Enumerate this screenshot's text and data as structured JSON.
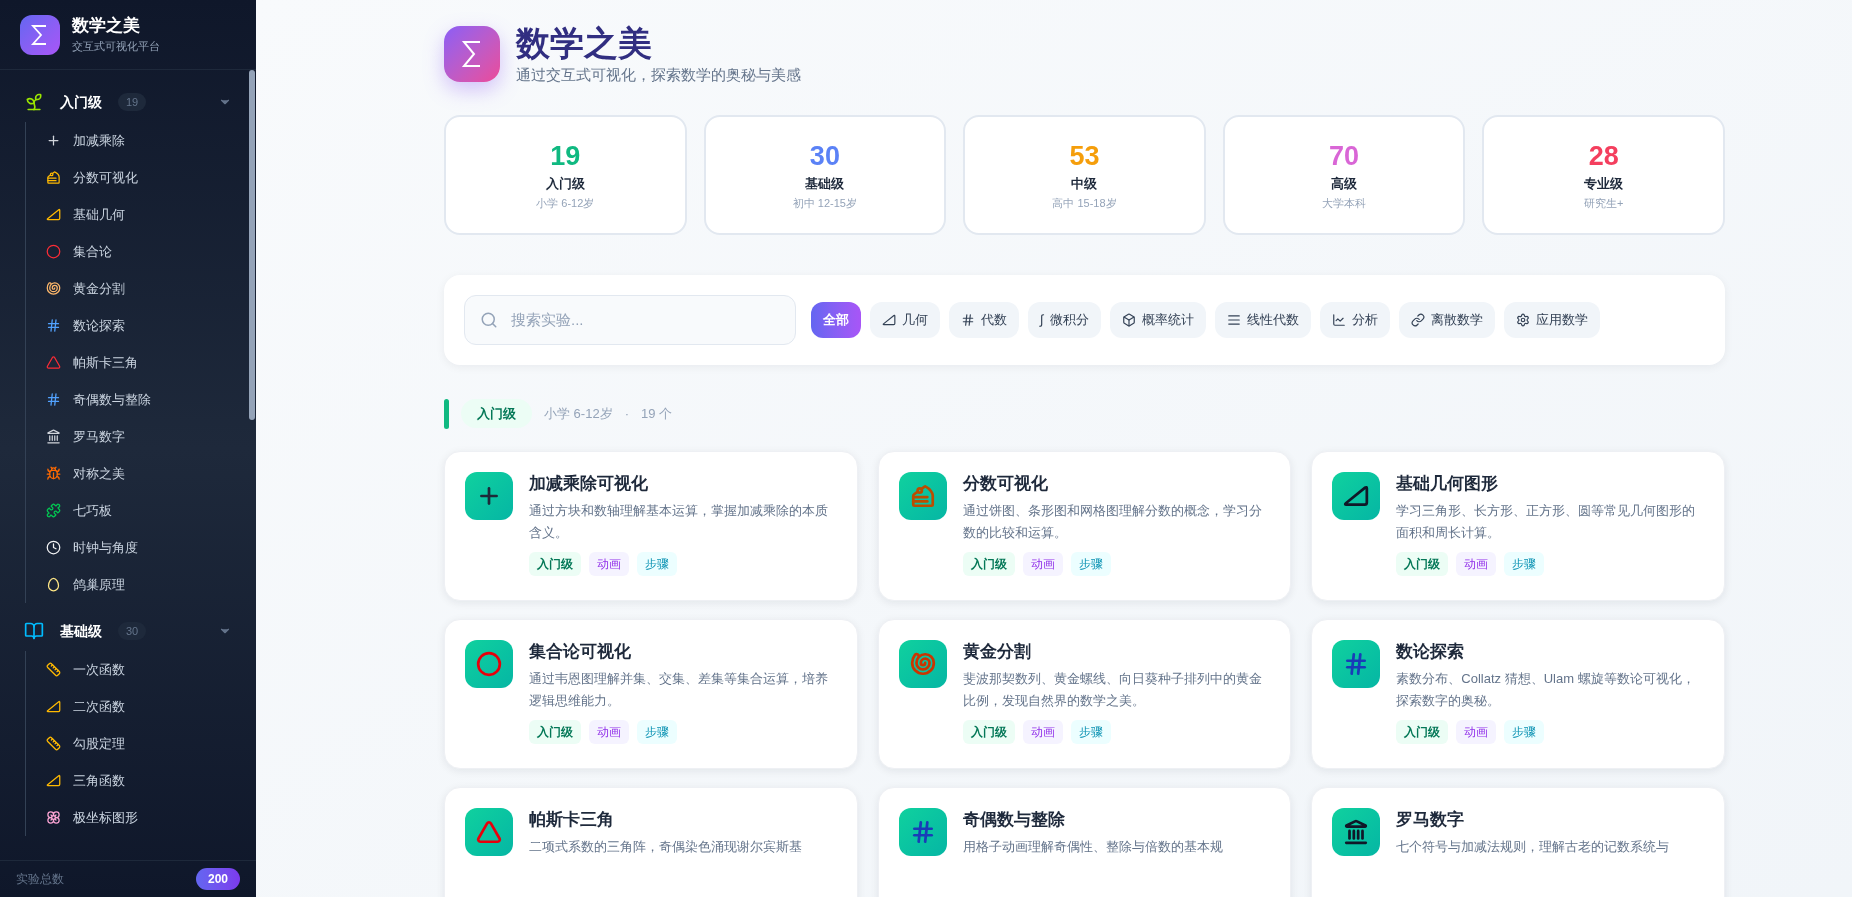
{
  "sidebar": {
    "brand": {
      "title": "数学之美",
      "subtitle": "交互式可视化平台"
    },
    "groups": [
      {
        "label": "入门级",
        "count": "19",
        "expanded": true,
        "items": [
          "加减乘除",
          "分数可视化",
          "基础几何",
          "集合论",
          "黄金分割",
          "数论探索",
          "帕斯卡三角",
          "奇偶数与整除",
          "罗马数字",
          "对称之美",
          "七巧板",
          "时钟与角度",
          "鸽巢原理"
        ]
      },
      {
        "label": "基础级",
        "count": "30",
        "expanded": true,
        "items": [
          "一次函数",
          "二次函数",
          "勾股定理",
          "三角函数",
          "极坐标图形"
        ]
      }
    ],
    "footer": {
      "label": "实验总数",
      "count": "200"
    }
  },
  "header": {
    "title": "数学之美",
    "subtitle": "通过交互式可视化，探索数学的奥秘与美感"
  },
  "stats": [
    {
      "value": "19",
      "label": "入门级",
      "range": "小学 6-12岁",
      "color": "#10b981"
    },
    {
      "value": "30",
      "label": "基础级",
      "range": "初中 12-15岁",
      "color": "#5b82f6"
    },
    {
      "value": "53",
      "label": "中级",
      "range": "高中 15-18岁",
      "color": "#f59e0b"
    },
    {
      "value": "70",
      "label": "高级",
      "range": "大学本科",
      "color": "#d966d6"
    },
    {
      "value": "28",
      "label": "专业级",
      "range": "研究生+",
      "color": "#f43f5e"
    }
  ],
  "filters": {
    "search": {
      "placeholder": "搜索实验..."
    },
    "chips": [
      {
        "label": "全部",
        "selected": true
      },
      {
        "label": "几何",
        "selected": false
      },
      {
        "label": "代数",
        "selected": false
      },
      {
        "glyph": "∫",
        "label": "微积分",
        "selected": false
      },
      {
        "label": "概率统计",
        "selected": false
      },
      {
        "label": "线性代数",
        "selected": false
      },
      {
        "label": "分析",
        "selected": false
      },
      {
        "label": "离散数学",
        "selected": false
      },
      {
        "label": "应用数学",
        "selected": false
      }
    ]
  },
  "section": {
    "level": "入门级",
    "range": "小学 6-12岁",
    "separator": "·",
    "count": "19 个"
  },
  "cards": [
    {
      "title": "加减乘除可视化",
      "description": "通过方块和数轴理解基本运算，掌握加减乘除的本质含义。",
      "tags": [
        {
          "kind": "level",
          "label": "入门级"
        },
        {
          "kind": "animation",
          "label": "动画"
        },
        {
          "kind": "steps",
          "label": "步骤"
        }
      ]
    },
    {
      "title": "分数可视化",
      "description": "通过饼图、条形图和网格图理解分数的概念，学习分数的比较和运算。",
      "tags": [
        {
          "kind": "level",
          "label": "入门级"
        },
        {
          "kind": "animation",
          "label": "动画"
        },
        {
          "kind": "steps",
          "label": "步骤"
        }
      ]
    },
    {
      "title": "基础几何图形",
      "description": "学习三角形、长方形、正方形、圆等常见几何图形的面积和周长计算。",
      "tags": [
        {
          "kind": "level",
          "label": "入门级"
        },
        {
          "kind": "animation",
          "label": "动画"
        },
        {
          "kind": "steps",
          "label": "步骤"
        }
      ]
    },
    {
      "title": "集合论可视化",
      "description": "通过韦恩图理解并集、交集、差集等集合运算，培养逻辑思维能力。",
      "tags": [
        {
          "kind": "level",
          "label": "入门级"
        },
        {
          "kind": "animation",
          "label": "动画"
        },
        {
          "kind": "steps",
          "label": "步骤"
        }
      ]
    },
    {
      "title": "黄金分割",
      "description": "斐波那契数列、黄金螺线、向日葵种子排列中的黄金比例，发现自然界的数学之美。",
      "tags": [
        {
          "kind": "level",
          "label": "入门级"
        },
        {
          "kind": "animation",
          "label": "动画"
        },
        {
          "kind": "steps",
          "label": "步骤"
        }
      ]
    },
    {
      "title": "数论探索",
      "description": "素数分布、Collatz 猜想、Ulam 螺旋等数论可视化，探索数字的奥秘。",
      "tags": [
        {
          "kind": "level",
          "label": "入门级"
        },
        {
          "kind": "animation",
          "label": "动画"
        },
        {
          "kind": "steps",
          "label": "步骤"
        }
      ]
    },
    {
      "title": "帕斯卡三角",
      "description": "二项式系数的三角阵，奇偶染色涌现谢尔宾斯基"
    },
    {
      "title": "奇偶数与整除",
      "description": "用格子动画理解奇偶性、整除与倍数的基本规"
    },
    {
      "title": "罗马数字",
      "description": "七个符号与加减法规则，理解古老的记数系统与"
    }
  ]
}
